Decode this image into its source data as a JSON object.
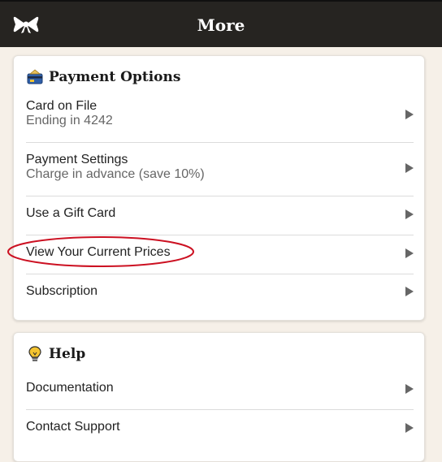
{
  "header": {
    "title": "More",
    "logo_icon": "bow-icon"
  },
  "payment_options": {
    "title": "Payment Options",
    "icon": "credit-card-icon",
    "items": [
      {
        "label": "Card on File",
        "sublabel": "Ending in 4242"
      },
      {
        "label": "Payment Settings",
        "sublabel": "Charge in advance (save 10%)"
      },
      {
        "label": "Use a Gift Card"
      },
      {
        "label": "View Your Current Prices",
        "highlighted": true
      },
      {
        "label": "Subscription"
      }
    ]
  },
  "help": {
    "title": "Help",
    "icon": "lightbulb-icon",
    "items": [
      {
        "label": "Documentation"
      },
      {
        "label": "Contact Support"
      }
    ]
  },
  "colors": {
    "header_bg": "#262421",
    "page_bg": "#f6f0e8",
    "highlight": "#cc1122",
    "chevron": "#666666"
  }
}
